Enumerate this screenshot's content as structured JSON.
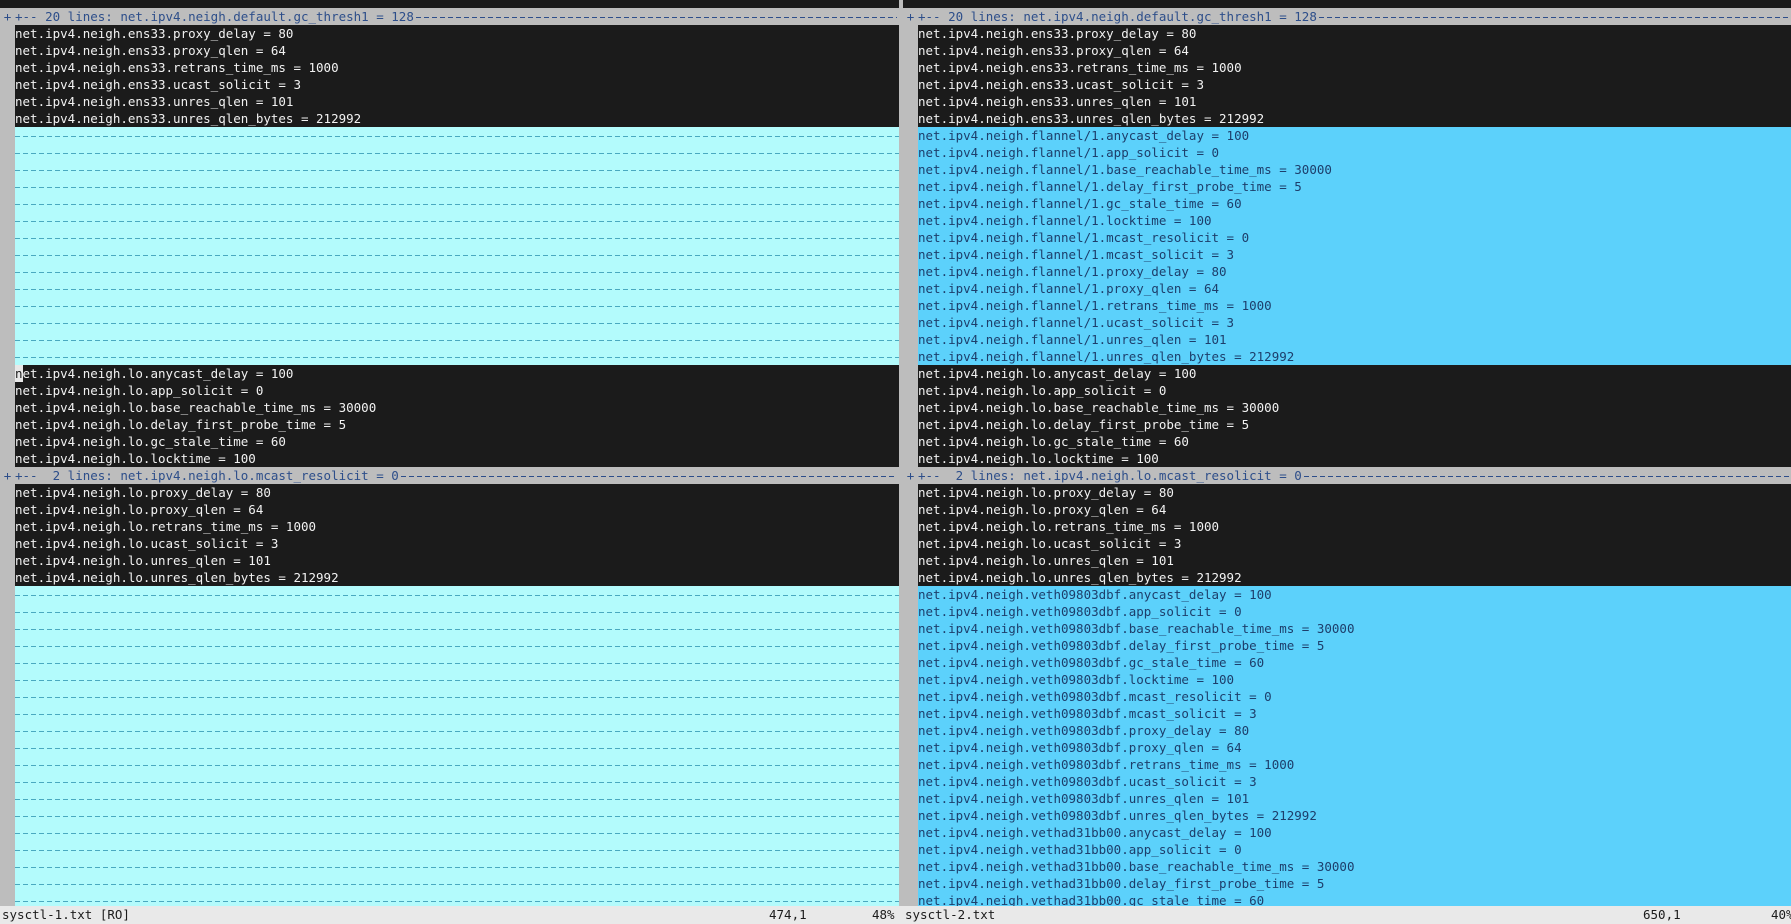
{
  "panes": {
    "left": {
      "lines": [
        {
          "kind": "fold",
          "text": "+-- 20 lines: net.ipv4.neigh.default.gc_thresh1 = 128"
        },
        {
          "kind": "same",
          "text": "net.ipv4.neigh.ens33.proxy_delay = 80"
        },
        {
          "kind": "same",
          "text": "net.ipv4.neigh.ens33.proxy_qlen = 64"
        },
        {
          "kind": "same",
          "text": "net.ipv4.neigh.ens33.retrans_time_ms = 1000"
        },
        {
          "kind": "same",
          "text": "net.ipv4.neigh.ens33.ucast_solicit = 3"
        },
        {
          "kind": "same",
          "text": "net.ipv4.neigh.ens33.unres_qlen = 101"
        },
        {
          "kind": "same",
          "text": "net.ipv4.neigh.ens33.unres_qlen_bytes = 212992"
        },
        {
          "kind": "filler",
          "text": ""
        },
        {
          "kind": "filler",
          "text": ""
        },
        {
          "kind": "filler",
          "text": ""
        },
        {
          "kind": "filler",
          "text": ""
        },
        {
          "kind": "filler",
          "text": ""
        },
        {
          "kind": "filler",
          "text": ""
        },
        {
          "kind": "filler",
          "text": ""
        },
        {
          "kind": "filler",
          "text": ""
        },
        {
          "kind": "filler",
          "text": ""
        },
        {
          "kind": "filler",
          "text": ""
        },
        {
          "kind": "filler",
          "text": ""
        },
        {
          "kind": "filler",
          "text": ""
        },
        {
          "kind": "filler",
          "text": ""
        },
        {
          "kind": "filler",
          "text": ""
        },
        {
          "kind": "same",
          "text": "net.ipv4.neigh.lo.anycast_delay = 100",
          "cursor": true
        },
        {
          "kind": "same",
          "text": "net.ipv4.neigh.lo.app_solicit = 0"
        },
        {
          "kind": "same",
          "text": "net.ipv4.neigh.lo.base_reachable_time_ms = 30000"
        },
        {
          "kind": "same",
          "text": "net.ipv4.neigh.lo.delay_first_probe_time = 5"
        },
        {
          "kind": "same",
          "text": "net.ipv4.neigh.lo.gc_stale_time = 60"
        },
        {
          "kind": "same",
          "text": "net.ipv4.neigh.lo.locktime = 100"
        },
        {
          "kind": "fold",
          "text": "+--  2 lines: net.ipv4.neigh.lo.mcast_resolicit = 0"
        },
        {
          "kind": "same",
          "text": "net.ipv4.neigh.lo.proxy_delay = 80"
        },
        {
          "kind": "same",
          "text": "net.ipv4.neigh.lo.proxy_qlen = 64"
        },
        {
          "kind": "same",
          "text": "net.ipv4.neigh.lo.retrans_time_ms = 1000"
        },
        {
          "kind": "same",
          "text": "net.ipv4.neigh.lo.ucast_solicit = 3"
        },
        {
          "kind": "same",
          "text": "net.ipv4.neigh.lo.unres_qlen = 101"
        },
        {
          "kind": "same",
          "text": "net.ipv4.neigh.lo.unres_qlen_bytes = 212992"
        },
        {
          "kind": "filler",
          "text": ""
        },
        {
          "kind": "filler",
          "text": ""
        },
        {
          "kind": "filler",
          "text": ""
        },
        {
          "kind": "filler",
          "text": ""
        },
        {
          "kind": "filler",
          "text": ""
        },
        {
          "kind": "filler",
          "text": ""
        },
        {
          "kind": "filler",
          "text": ""
        },
        {
          "kind": "filler",
          "text": ""
        },
        {
          "kind": "filler",
          "text": ""
        },
        {
          "kind": "filler",
          "text": ""
        },
        {
          "kind": "filler",
          "text": ""
        },
        {
          "kind": "filler",
          "text": ""
        },
        {
          "kind": "filler",
          "text": ""
        },
        {
          "kind": "filler",
          "text": ""
        },
        {
          "kind": "filler",
          "text": ""
        },
        {
          "kind": "filler",
          "text": ""
        },
        {
          "kind": "filler",
          "text": ""
        },
        {
          "kind": "filler",
          "text": ""
        },
        {
          "kind": "filler",
          "text": ""
        }
      ]
    },
    "right": {
      "lines": [
        {
          "kind": "fold",
          "text": "+-- 20 lines: net.ipv4.neigh.default.gc_thresh1 = 128"
        },
        {
          "kind": "same",
          "text": "net.ipv4.neigh.ens33.proxy_delay = 80"
        },
        {
          "kind": "same",
          "text": "net.ipv4.neigh.ens33.proxy_qlen = 64"
        },
        {
          "kind": "same",
          "text": "net.ipv4.neigh.ens33.retrans_time_ms = 1000"
        },
        {
          "kind": "same",
          "text": "net.ipv4.neigh.ens33.ucast_solicit = 3"
        },
        {
          "kind": "same",
          "text": "net.ipv4.neigh.ens33.unres_qlen = 101"
        },
        {
          "kind": "same",
          "text": "net.ipv4.neigh.ens33.unres_qlen_bytes = 212992"
        },
        {
          "kind": "added",
          "text": "net.ipv4.neigh.flannel/1.anycast_delay = 100"
        },
        {
          "kind": "added",
          "text": "net.ipv4.neigh.flannel/1.app_solicit = 0"
        },
        {
          "kind": "added",
          "text": "net.ipv4.neigh.flannel/1.base_reachable_time_ms = 30000"
        },
        {
          "kind": "added",
          "text": "net.ipv4.neigh.flannel/1.delay_first_probe_time = 5"
        },
        {
          "kind": "added",
          "text": "net.ipv4.neigh.flannel/1.gc_stale_time = 60"
        },
        {
          "kind": "added",
          "text": "net.ipv4.neigh.flannel/1.locktime = 100"
        },
        {
          "kind": "added",
          "text": "net.ipv4.neigh.flannel/1.mcast_resolicit = 0"
        },
        {
          "kind": "added",
          "text": "net.ipv4.neigh.flannel/1.mcast_solicit = 3"
        },
        {
          "kind": "added",
          "text": "net.ipv4.neigh.flannel/1.proxy_delay = 80"
        },
        {
          "kind": "added",
          "text": "net.ipv4.neigh.flannel/1.proxy_qlen = 64"
        },
        {
          "kind": "added",
          "text": "net.ipv4.neigh.flannel/1.retrans_time_ms = 1000"
        },
        {
          "kind": "added",
          "text": "net.ipv4.neigh.flannel/1.ucast_solicit = 3"
        },
        {
          "kind": "added",
          "text": "net.ipv4.neigh.flannel/1.unres_qlen = 101"
        },
        {
          "kind": "added",
          "text": "net.ipv4.neigh.flannel/1.unres_qlen_bytes = 212992"
        },
        {
          "kind": "same",
          "text": "net.ipv4.neigh.lo.anycast_delay = 100"
        },
        {
          "kind": "same",
          "text": "net.ipv4.neigh.lo.app_solicit = 0"
        },
        {
          "kind": "same",
          "text": "net.ipv4.neigh.lo.base_reachable_time_ms = 30000"
        },
        {
          "kind": "same",
          "text": "net.ipv4.neigh.lo.delay_first_probe_time = 5"
        },
        {
          "kind": "same",
          "text": "net.ipv4.neigh.lo.gc_stale_time = 60"
        },
        {
          "kind": "same",
          "text": "net.ipv4.neigh.lo.locktime = 100"
        },
        {
          "kind": "fold",
          "text": "+--  2 lines: net.ipv4.neigh.lo.mcast_resolicit = 0"
        },
        {
          "kind": "same",
          "text": "net.ipv4.neigh.lo.proxy_delay = 80"
        },
        {
          "kind": "same",
          "text": "net.ipv4.neigh.lo.proxy_qlen = 64"
        },
        {
          "kind": "same",
          "text": "net.ipv4.neigh.lo.retrans_time_ms = 1000"
        },
        {
          "kind": "same",
          "text": "net.ipv4.neigh.lo.ucast_solicit = 3"
        },
        {
          "kind": "same",
          "text": "net.ipv4.neigh.lo.unres_qlen = 101"
        },
        {
          "kind": "same",
          "text": "net.ipv4.neigh.lo.unres_qlen_bytes = 212992"
        },
        {
          "kind": "added",
          "text": "net.ipv4.neigh.veth09803dbf.anycast_delay = 100"
        },
        {
          "kind": "added",
          "text": "net.ipv4.neigh.veth09803dbf.app_solicit = 0"
        },
        {
          "kind": "added",
          "text": "net.ipv4.neigh.veth09803dbf.base_reachable_time_ms = 30000"
        },
        {
          "kind": "added",
          "text": "net.ipv4.neigh.veth09803dbf.delay_first_probe_time = 5"
        },
        {
          "kind": "added",
          "text": "net.ipv4.neigh.veth09803dbf.gc_stale_time = 60"
        },
        {
          "kind": "added",
          "text": "net.ipv4.neigh.veth09803dbf.locktime = 100"
        },
        {
          "kind": "added",
          "text": "net.ipv4.neigh.veth09803dbf.mcast_resolicit = 0"
        },
        {
          "kind": "added",
          "text": "net.ipv4.neigh.veth09803dbf.mcast_solicit = 3"
        },
        {
          "kind": "added",
          "text": "net.ipv4.neigh.veth09803dbf.proxy_delay = 80"
        },
        {
          "kind": "added",
          "text": "net.ipv4.neigh.veth09803dbf.proxy_qlen = 64"
        },
        {
          "kind": "added",
          "text": "net.ipv4.neigh.veth09803dbf.retrans_time_ms = 1000"
        },
        {
          "kind": "added",
          "text": "net.ipv4.neigh.veth09803dbf.ucast_solicit = 3"
        },
        {
          "kind": "added",
          "text": "net.ipv4.neigh.veth09803dbf.unres_qlen = 101"
        },
        {
          "kind": "added",
          "text": "net.ipv4.neigh.veth09803dbf.unres_qlen_bytes = 212992"
        },
        {
          "kind": "added",
          "text": "net.ipv4.neigh.vethad31bb00.anycast_delay = 100"
        },
        {
          "kind": "added",
          "text": "net.ipv4.neigh.vethad31bb00.app_solicit = 0"
        },
        {
          "kind": "added",
          "text": "net.ipv4.neigh.vethad31bb00.base_reachable_time_ms = 30000"
        },
        {
          "kind": "added",
          "text": "net.ipv4.neigh.vethad31bb00.delay_first_probe_time = 5"
        },
        {
          "kind": "added",
          "text": "net.ipv4.neigh.vethad31bb00.gc_stale_time = 60"
        }
      ]
    }
  },
  "status": {
    "left": {
      "file": "sysctl-1.txt [RO]",
      "position": "474,1",
      "percent": "48%"
    },
    "right": {
      "file": "sysctl-2.txt",
      "position": "650,1",
      "percent": "40%"
    }
  },
  "gutter_glyphs": {
    "fold": "+",
    "normal": ""
  },
  "colors": {
    "background": "#1b1b1b",
    "filler": "#b3fbfc",
    "added": "#5cd1fb",
    "fold": "#bdbdbd",
    "fold_text": "#2d4e8a",
    "status": "#e9e9e9"
  }
}
